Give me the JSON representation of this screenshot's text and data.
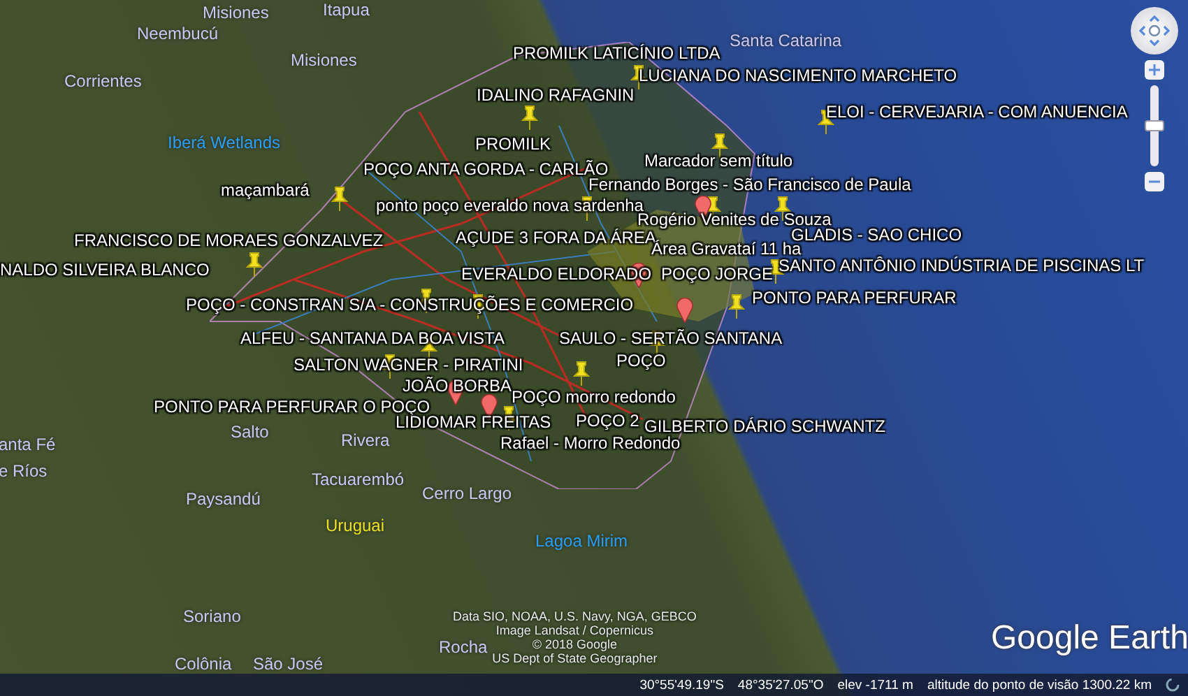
{
  "map": {
    "region_labels": [
      {
        "text": "Itapua",
        "kind": "region"
      },
      {
        "text": "Misiones",
        "kind": "region"
      },
      {
        "text": "Neembucú",
        "kind": "region"
      },
      {
        "text": "Misiones",
        "kind": "region"
      },
      {
        "text": "Corrientes",
        "kind": "region"
      },
      {
        "text": "Santa Catarina",
        "kind": "region"
      },
      {
        "text": "Iberá Wetlands",
        "kind": "water"
      },
      {
        "text": "anta Fé",
        "kind": "region"
      },
      {
        "text": "e Ríos",
        "kind": "region"
      },
      {
        "text": "Salto",
        "kind": "region"
      },
      {
        "text": "Rivera",
        "kind": "region"
      },
      {
        "text": "Tacuarembó",
        "kind": "region"
      },
      {
        "text": "Paysandú",
        "kind": "region"
      },
      {
        "text": "Cerro Largo",
        "kind": "region"
      },
      {
        "text": "Uruguai",
        "kind": "country"
      },
      {
        "text": "Lagoa Mirim",
        "kind": "water"
      },
      {
        "text": "Soriano",
        "kind": "region"
      },
      {
        "text": "Rocha",
        "kind": "region"
      },
      {
        "text": "Colônia",
        "kind": "region"
      },
      {
        "text": "São José",
        "kind": "region"
      }
    ],
    "placemarks": [
      {
        "text": "PROMILK LATICÍNIO LTDA"
      },
      {
        "text": "LUCIANA DO NASCIMENTO MARCHETO"
      },
      {
        "text": "IDALINO RAFAGNIN"
      },
      {
        "text": "ELOI - CERVEJARIA  - COM ANUENCIA"
      },
      {
        "text": "PROMILK"
      },
      {
        "text": "Marcador sem título"
      },
      {
        "text": "POÇO ANTA GORDA - CARLÃO"
      },
      {
        "text": "maçambará"
      },
      {
        "text": "Fernando Borges - São Francisco de Paula"
      },
      {
        "text": "ponto poço everaldo nova sardenha"
      },
      {
        "text": "Rogério Venites de Souza"
      },
      {
        "text": "FRANCISCO DE MORAES GONZALVEZ"
      },
      {
        "text": "AÇUDE 3 FORA DA ÁREA"
      },
      {
        "text": "GLADIS - SAO CHICO"
      },
      {
        "text": "Área Gravataí 11 ha"
      },
      {
        "text": "NALDO SILVEIRA BLANCO"
      },
      {
        "text": "SANTO ANTÔNIO INDÚSTRIA DE PISCINAS LT"
      },
      {
        "text": "EVERALDO ELDORADO"
      },
      {
        "text": "POÇO JORGE"
      },
      {
        "text": "POÇO - CONSTRAN S/A - CONSTRUÇÕES E COMERCIO"
      },
      {
        "text": "PONTO PARA PERFURAR"
      },
      {
        "text": "ALFEU - SANTANA DA BOA VISTA"
      },
      {
        "text": "SAULO - SERTÃO SANTANA"
      },
      {
        "text": "POÇO"
      },
      {
        "text": "SALTON  WAGNER - PIRATINI"
      },
      {
        "text": "JOÃO BORBA"
      },
      {
        "text": "POÇO morro redondo"
      },
      {
        "text": "PONTO PARA PERFURAR O POÇO"
      },
      {
        "text": "LIDIOMAR FREITAS"
      },
      {
        "text": "POÇO 2"
      },
      {
        "text": "GILBERTO DÁRIO SCHWANTZ"
      },
      {
        "text": "Rafael - Morro Redondo"
      }
    ],
    "attribution": [
      "Data SIO, NOAA, U.S. Navy, NGA, GEBCO",
      "Image Landsat / Copernicus",
      "© 2018 Google",
      "US Dept of State Geographer"
    ],
    "logo": "Google Earth"
  },
  "navigation": {
    "zoom": {
      "level": 0.5
    }
  },
  "status_bar": {
    "latitude": "30°55'49.19\"S",
    "longitude": "48°35'27.05\"O",
    "elevation": "elev -1711 m",
    "eye_altitude": "altitude do ponto de visão 1300.22 km"
  }
}
